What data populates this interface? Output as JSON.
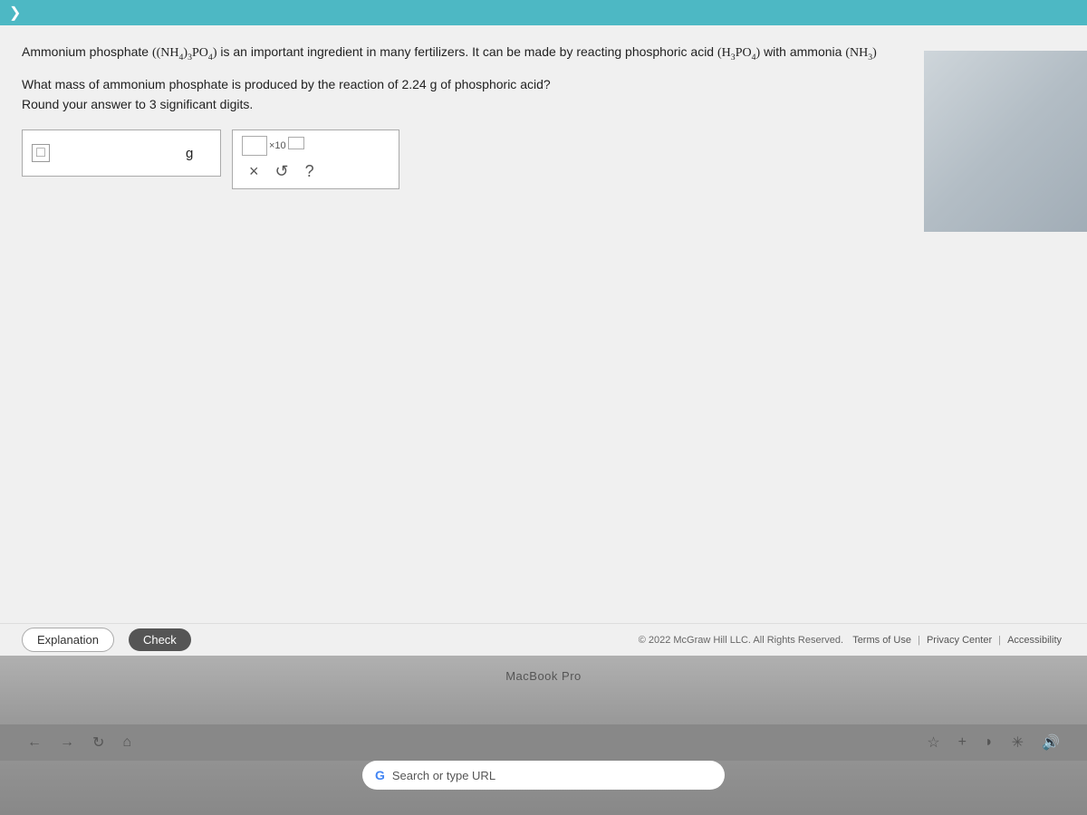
{
  "topbar": {
    "chevron": "❯"
  },
  "problem": {
    "intro": "Ammonium phosphate ",
    "formula_ammonium_phosphate": "((NH₄)₃PO₄)",
    "intro_mid": " is an important ingredient in many fertilizers. It can be made by reacting phosphoric acid ",
    "formula_phosphoric_acid": "(H₃PO₄)",
    "intro_end": " with ammonia ",
    "formula_ammonia": "(NH₃)",
    "question": "What mass of ammonium phosphate is produced by the reaction of 2.24 g of phosphoric acid?",
    "instruction": "Round your answer to 3 significant digits."
  },
  "answer_input": {
    "placeholder": "",
    "unit": "g"
  },
  "sci_notation": {
    "base_placeholder": "",
    "exp_label": "×10",
    "exp_placeholder": ""
  },
  "buttons": {
    "explanation": "Explanation",
    "check": "Check",
    "undo": "↺",
    "help": "?",
    "clear": "×"
  },
  "footer": {
    "copyright": "© 2022 McGraw Hill LLC. All Rights Reserved.",
    "terms": "Terms of Use",
    "privacy": "Privacy Center",
    "accessibility": "Accessibility"
  },
  "macbook": {
    "label": "MacBook Pro",
    "search_placeholder": "Search or type URL",
    "search_icon": "G"
  },
  "toolbar_icons": {
    "back": "←",
    "forward": "→",
    "refresh": "↻",
    "home": "⌂",
    "star": "☆",
    "plus": "+",
    "moon": "◗",
    "speaker": "🔊",
    "settings": "✳",
    "volume": "🔉"
  }
}
